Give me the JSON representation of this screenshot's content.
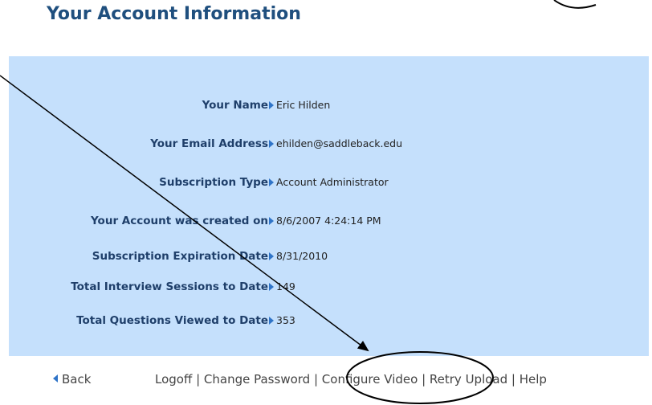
{
  "page": {
    "title": "Your Account Information"
  },
  "account": {
    "rows": [
      {
        "label": "Your Name",
        "value": "Eric Hilden"
      },
      {
        "label": "Your Email Address",
        "value": "ehilden@saddleback.edu"
      },
      {
        "label": "Subscription Type",
        "value": "Account Administrator"
      },
      {
        "label": "Your Account was created on",
        "value": "8/6/2007 4:24:14 PM"
      },
      {
        "label": "Subscription Expiration Date",
        "value": "8/31/2010"
      },
      {
        "label": "Total Interview Sessions to Date",
        "value": "149"
      },
      {
        "label": "Total Questions Viewed to Date",
        "value": "353"
      }
    ]
  },
  "footer": {
    "back_label": "Back",
    "links": [
      "Logoff",
      "Change Password",
      "Configure Video",
      "Retry Upload",
      "Help"
    ],
    "separator": "|"
  },
  "colors": {
    "title": "#1f4f7e",
    "panel_background": "#c5e0fc",
    "label": "#1f3f6a",
    "arrow_accent": "#2f74c8"
  },
  "icons": {
    "row_pointer": "triangle-right-icon",
    "back": "triangle-left-icon"
  }
}
